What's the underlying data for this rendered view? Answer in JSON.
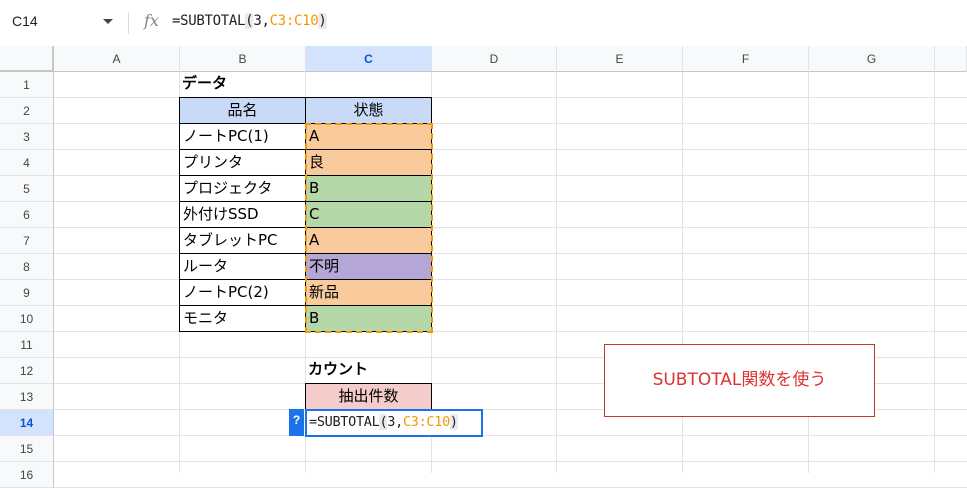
{
  "formula_bar": {
    "name_box": "C14",
    "fx_icon": "fx",
    "formula_parts": [
      "=SUBTOTAL",
      "(",
      "3,",
      "C3:C10",
      ")"
    ]
  },
  "columns": [
    "A",
    "B",
    "C",
    "D",
    "E",
    "F",
    "G"
  ],
  "rows": [
    "1",
    "2",
    "3",
    "4",
    "5",
    "6",
    "7",
    "8",
    "9",
    "10",
    "11",
    "12",
    "13",
    "14",
    "15",
    "16"
  ],
  "selected": {
    "column": "C",
    "row": "14"
  },
  "sheet": {
    "data_title": "データ",
    "table_headers": [
      "品名",
      "状態"
    ],
    "table_rows": [
      {
        "item": "ノートPC(1)",
        "status": "A"
      },
      {
        "item": "プリンタ",
        "status": "良"
      },
      {
        "item": "プロジェクタ",
        "status": "B"
      },
      {
        "item": "外付けSSD",
        "status": "C"
      },
      {
        "item": "タブレットPC",
        "status": "A"
      },
      {
        "item": "ルータ",
        "status": "不明"
      },
      {
        "item": "ノートPC(2)",
        "status": "新品"
      },
      {
        "item": "モニタ",
        "status": "B"
      }
    ],
    "status_colors": [
      "#f9cb9c",
      "#f9cb9c",
      "#b6d7a8",
      "#b6d7a8",
      "#f9cb9c",
      "#b4a7d6",
      "#f9cb9c",
      "#b6d7a8"
    ],
    "header_color": "#c9daf8",
    "count_title": "カウント",
    "count_header": "抽出件数",
    "count_header_color": "#f4cccc",
    "editor_parts": [
      "=SUBTOTAL",
      "(",
      "3,",
      "C3:C10",
      ")"
    ],
    "help_badge": "?"
  },
  "callout": {
    "text": "SUBTOTAL関数を使う"
  },
  "colors": {
    "range_highlight": "#f29900",
    "selection": "#1a73e8",
    "callout_text": "#e03131"
  }
}
